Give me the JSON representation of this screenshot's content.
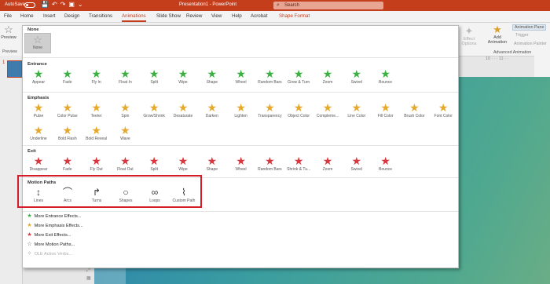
{
  "titlebar": {
    "autosave_label": "AutoSave",
    "autosave_state": "Off",
    "document_title": "Presentation1  -  PowerPoint",
    "search_placeholder": "Search"
  },
  "tabs": [
    {
      "label": "File"
    },
    {
      "label": "Home"
    },
    {
      "label": "Insert"
    },
    {
      "label": "Design"
    },
    {
      "label": "Transitions"
    },
    {
      "label": "Animations",
      "active": true
    },
    {
      "label": "Slide Show"
    },
    {
      "label": "Review"
    },
    {
      "label": "View"
    },
    {
      "label": "Help"
    },
    {
      "label": "Acrobat"
    },
    {
      "label": "Shape Format",
      "context": true
    }
  ],
  "ribbon": {
    "preview_label": "Preview",
    "preview_group": "Preview",
    "effect_options_label": "Effect Options",
    "add_animation_label": "Add Animation",
    "animation_pane_label": "Animation Pane",
    "trigger_label": "Trigger",
    "animation_painter_label": "Animation Painter",
    "advanced_group": "Advanced Animation",
    "ruler_marks": "10 · · · 11 · ·"
  },
  "slide_panel": {
    "slide_number": "1"
  },
  "gallery": {
    "none_title": "None",
    "none_item": "None",
    "sections": [
      {
        "title": "Entrance",
        "kind": "enter",
        "items": [
          "Appear",
          "Fade",
          "Fly In",
          "Float In",
          "Split",
          "Wipe",
          "Shape",
          "Wheel",
          "Random Bars",
          "Grow & Turn",
          "Zoom",
          "Swivel",
          "Bounce"
        ]
      },
      {
        "title": "Emphasis",
        "kind": "emph",
        "items": [
          "Pulse",
          "Color Pulse",
          "Teeter",
          "Spin",
          "Grow/Shrink",
          "Desaturate",
          "Darken",
          "Lighten",
          "Transparency",
          "Object Color",
          "Compleme...",
          "Line Color",
          "Fill Color",
          "Brush Color",
          "Font Color",
          "Underline",
          "Bold Flash",
          "Bold Reveal",
          "Wave"
        ]
      },
      {
        "title": "Exit",
        "kind": "exit",
        "items": [
          "Disappear",
          "Fade",
          "Fly Out",
          "Float Out",
          "Split",
          "Wipe",
          "Shape",
          "Wheel",
          "Random Bars",
          "Shrink & Tu...",
          "Zoom",
          "Swivel",
          "Bounce"
        ]
      },
      {
        "title": "Motion Paths",
        "kind": "motion",
        "items": [
          "Lines",
          "Arcs",
          "Turns",
          "Shapes",
          "Loops",
          "Custom Path"
        ]
      }
    ],
    "more_items": [
      {
        "label": "More Entrance Effects...",
        "icon": "star-green-icon",
        "enabled": true
      },
      {
        "label": "More Emphasis Effects...",
        "icon": "star-gold-icon",
        "enabled": true
      },
      {
        "label": "More Exit Effects...",
        "icon": "star-red-icon",
        "enabled": true
      },
      {
        "label": "More Motion Paths...",
        "icon": "star-outline-icon",
        "enabled": true
      },
      {
        "label": "OLE Action Verbs...",
        "icon": "ole-icon",
        "enabled": false
      }
    ]
  },
  "colors": {
    "accent": "#c43e1c",
    "entrance": "#3cb043",
    "emphasis": "#e6a82a",
    "exit": "#d9363e",
    "highlight_box": "#d31d2a"
  }
}
